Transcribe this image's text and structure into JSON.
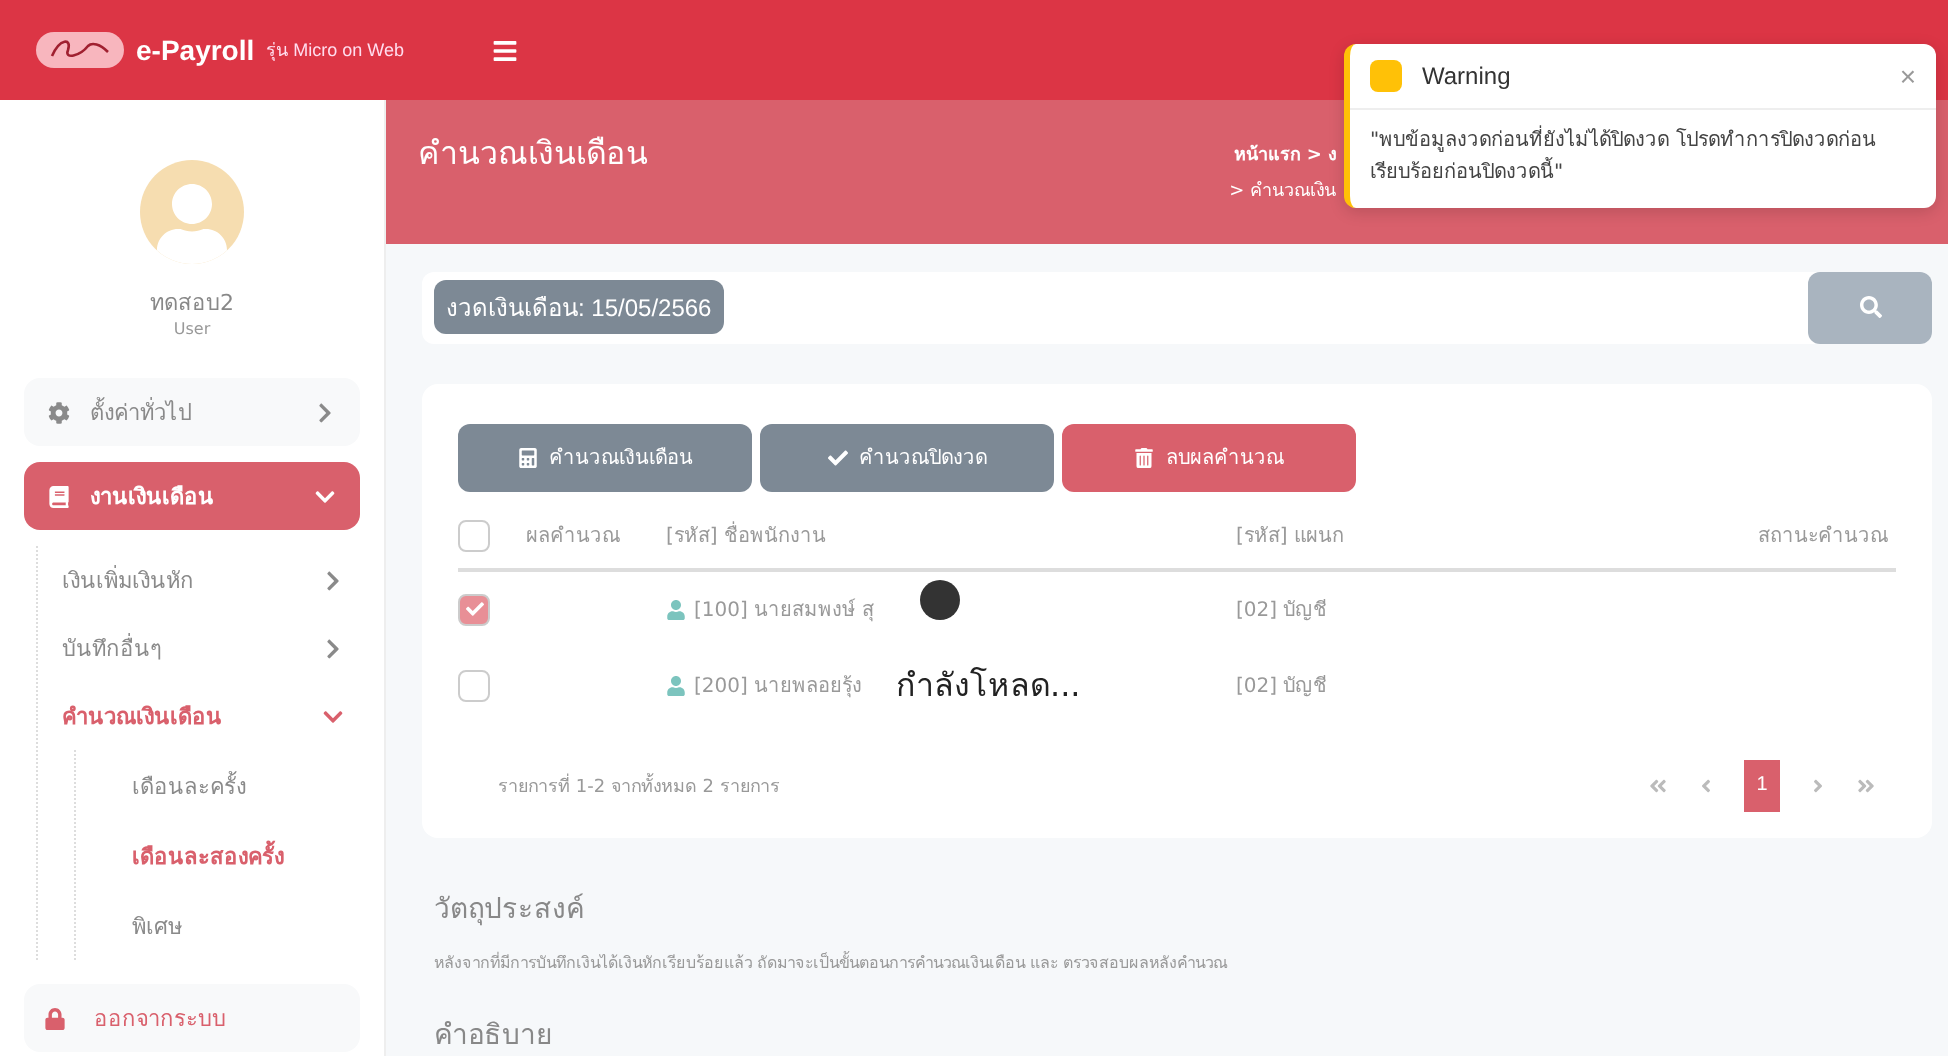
{
  "topbar": {
    "brand": "e-Payroll",
    "edition": "รุ่น Micro",
    "edition_suffix": "on Web"
  },
  "sidebar": {
    "user": {
      "name": "ทดสอบ2",
      "role": "User"
    },
    "menu": [
      {
        "label": "ตั้งค่าทั่วไป",
        "expanded": false,
        "selected": false
      },
      {
        "label": "งานเงินเดือน",
        "expanded": true,
        "selected": true,
        "children": [
          {
            "label": "เงินเพิ่มเงินหัก",
            "expanded": false,
            "selected": false
          },
          {
            "label": "บันทึกอื่นๆ",
            "expanded": false,
            "selected": false
          },
          {
            "label": "คำนวณเงินเดือน",
            "expanded": true,
            "selected": true,
            "children": [
              {
                "label": "เดือนละครั้ง",
                "selected": false
              },
              {
                "label": "เดือนละสองครั้ง",
                "selected": true
              },
              {
                "label": "พิเศษ",
                "selected": false
              }
            ]
          }
        ]
      }
    ],
    "logout": "ออกจากระบบ"
  },
  "page": {
    "title": "คำนวณเงินเดือน",
    "breadcrumb": [
      "หน้าแรก > ง",
      "> คำนวณเงิน"
    ]
  },
  "period": {
    "label": "งวดเงินเดือน: 15/05/2566"
  },
  "actions": [
    {
      "label": "คำนวณเงินเดือน",
      "kind": "calculate"
    },
    {
      "label": "คำนวณปิดงวด",
      "kind": "close"
    },
    {
      "label": "ลบผลคำนวณ",
      "kind": "delete"
    }
  ],
  "table": {
    "all_checked": false,
    "columns": [
      "ผลคำนวณ",
      "[รหัส] ชื่อพนักงาน",
      "[รหัส] แผนก",
      "สถานะคำนวณ"
    ],
    "rows": [
      {
        "checked": true,
        "employee": "[100] นายสมพงษ์ สุ",
        "department": "[02] บัญชี"
      },
      {
        "checked": false,
        "employee": "[200] นายพลอยรุ้ง",
        "department": "[02] บัญชี"
      }
    ],
    "summary": "รายการที่ 1-2 จากทั้งหมด 2 รายการ",
    "pages": [
      {
        "label": "1",
        "selected": true
      }
    ]
  },
  "sections": [
    {
      "heading": "วัตถุประสงค์",
      "text": "หลังจากที่มีการบันทึกเงินได้เงินหักเรียบร้อยแล้ว ถัดมาจะเป็นขั้นตอนการคำนวณเงินเดือน และ ตรวจสอบผลหลังคำนวณ"
    },
    {
      "heading": "คำอธิบาย"
    }
  ],
  "loading": {
    "text": "กำลังโหลด..."
  },
  "toast": {
    "title": "Warning",
    "close": "×",
    "message": "\"พบข้อมูลงวดก่อนที่ยังไม่ได้ปิดงวด โปรดทำการปิดงวดก่อนเรียบร้อยก่อนปิดงวดนี้\""
  }
}
